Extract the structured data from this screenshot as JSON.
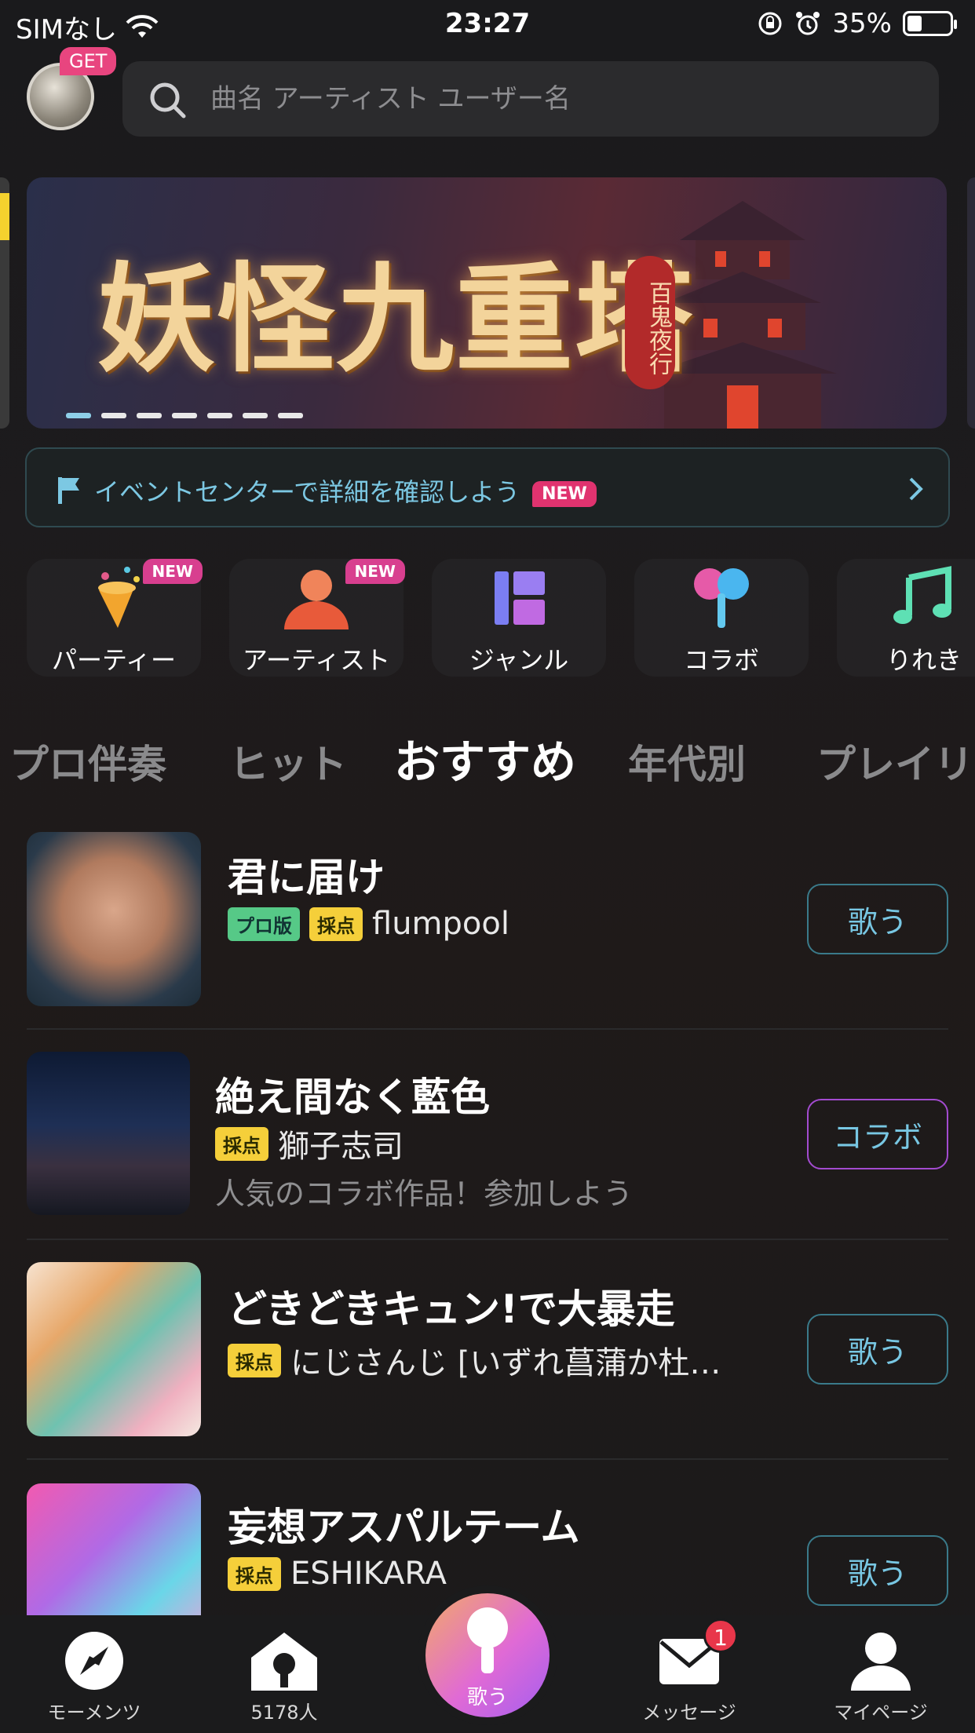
{
  "status_bar": {
    "carrier": "SIMなし",
    "time": "23:27",
    "battery": "35%"
  },
  "header": {
    "get_badge": "GET",
    "search_placeholder": "曲名 アーティスト ユーザー名"
  },
  "banner": {
    "title": "妖怪九重塔",
    "subtitle": "百鬼夜行",
    "slide_count": 7,
    "active_slide": 1
  },
  "event_bar": {
    "text": "イベントセンターで詳細を確認しよう",
    "badge": "NEW"
  },
  "categories": [
    {
      "label": "パーティー",
      "badge": "NEW",
      "icon": "party-cone-icon"
    },
    {
      "label": "アーティスト",
      "badge": "NEW",
      "icon": "artist-person-icon"
    },
    {
      "label": "ジャンル",
      "badge": "",
      "icon": "genre-grid-icon"
    },
    {
      "label": "コラボ",
      "badge": "",
      "icon": "collab-mic-icon"
    },
    {
      "label": "りれき",
      "badge": "",
      "icon": "music-note-icon"
    }
  ],
  "tabs": [
    "プロ伴奏",
    "ヒット",
    "おすすめ",
    "年代別",
    "プレイリ"
  ],
  "active_tab": "おすすめ",
  "songs": [
    {
      "title": "君に届け",
      "tags": [
        "プロ版",
        "採点"
      ],
      "artist": "flumpool",
      "sub": "",
      "button": "歌う"
    },
    {
      "title": "絶え間なく藍色",
      "tags": [
        "採点"
      ],
      "artist": "獅子志司",
      "sub": "人気のコラボ作品！参加しよう",
      "button": "コラボ"
    },
    {
      "title": "どきどきキュン!で大暴走",
      "tags": [
        "採点"
      ],
      "artist": "にじさんじ [いずれ菖蒲か杜…",
      "sub": "",
      "button": "歌う"
    },
    {
      "title": "妄想アスパルテーム",
      "tags": [
        "採点"
      ],
      "artist": "ESHIKARA",
      "sub": "",
      "button": "歌う"
    }
  ],
  "bottom_nav": {
    "moments": "モーメンツ",
    "room": "5178人",
    "sing": "歌う",
    "messages": "メッセージ",
    "message_badge": "1",
    "mypage": "マイページ"
  },
  "colors": {
    "accent": "#78c7e3",
    "new_badge": "#e0336f",
    "score_tag": "#f5cf3a",
    "pro_tag": "#56c987"
  }
}
